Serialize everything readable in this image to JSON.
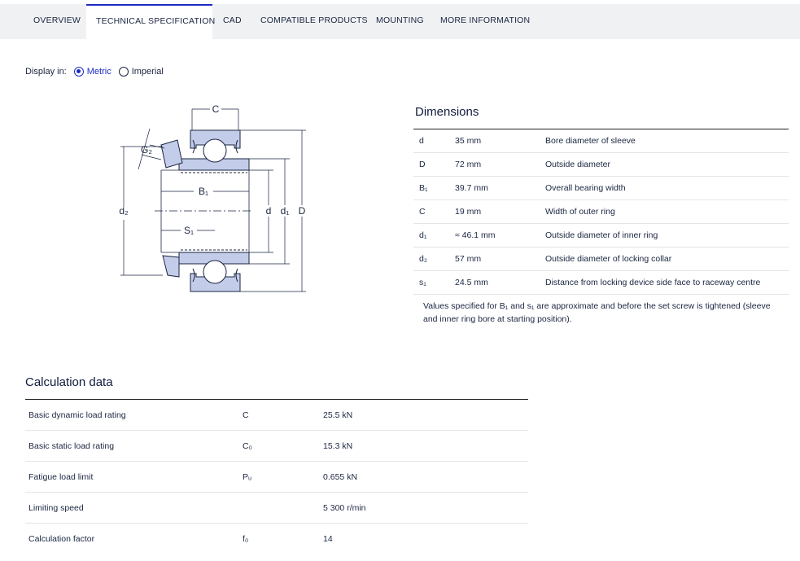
{
  "tabs": [
    {
      "label": "OVERVIEW"
    },
    {
      "label": "TECHNICAL SPECIFICATION"
    },
    {
      "label": "CAD"
    },
    {
      "label": "COMPATIBLE PRODUCTS"
    },
    {
      "label": "MOUNTING"
    },
    {
      "label": "MORE INFORMATION"
    }
  ],
  "active_tab": "TECHNICAL SPECIFICATION",
  "display_in": {
    "label": "Display in:",
    "options": [
      {
        "label": "Metric",
        "checked": true
      },
      {
        "label": "Imperial",
        "checked": false
      }
    ]
  },
  "drawing": {
    "labels": {
      "C": "C",
      "G2": "G₂",
      "B1": "B₁",
      "S1": "S₁",
      "d2": "d₂",
      "d": "d",
      "d1": "d₁",
      "D": "D"
    }
  },
  "dimensions": {
    "title": "Dimensions",
    "rows": [
      {
        "symbol": "d",
        "value": "35 mm",
        "description": "Bore diameter of sleeve"
      },
      {
        "symbol": "D",
        "value": "72 mm",
        "description": "Outside diameter"
      },
      {
        "symbol": "B₁",
        "value": "39.7 mm",
        "description": "Overall bearing width"
      },
      {
        "symbol": "C",
        "value": "19 mm",
        "description": "Width of outer ring"
      },
      {
        "symbol": "d₁",
        "value": "≈ 46.1 mm",
        "description": "Outside diameter of inner ring"
      },
      {
        "symbol": "d₂",
        "value": "57 mm",
        "description": "Outside diameter of locking collar"
      },
      {
        "symbol": "s₁",
        "value": "24.5 mm",
        "description": "Distance from locking device side face to raceway centre"
      }
    ],
    "note": "Values specified for B₁ and s₁ are approximate and before the set screw is tightened (sleeve and inner ring bore at starting position)."
  },
  "calculation": {
    "title": "Calculation data",
    "rows": [
      {
        "label": "Basic dynamic load rating",
        "symbol": "C",
        "value": "25.5 kN"
      },
      {
        "label": "Basic static load rating",
        "symbol": "C₀",
        "value": "15.3 kN"
      },
      {
        "label": "Fatigue load limit",
        "symbol": "Pᵤ",
        "value": "0.655 kN"
      },
      {
        "label": "Limiting speed",
        "symbol": "",
        "value": "5 300 r/min"
      },
      {
        "label": "Calculation factor",
        "symbol": "f₀",
        "value": "14"
      }
    ]
  },
  "colors": {
    "accent": "#1d2bc2",
    "tab_bar": "#f0f1f3",
    "bearing_fill": "#c3cdea",
    "bearing_stroke": "#1a2540"
  }
}
